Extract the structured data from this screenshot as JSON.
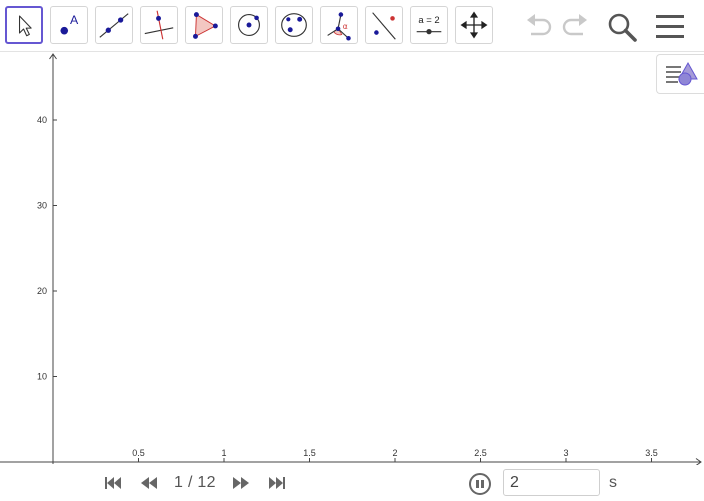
{
  "toolbar": {
    "tools": [
      {
        "name": "move-tool",
        "icon": "arrow-cursor-icon",
        "selected": true
      },
      {
        "name": "point-tool",
        "icon": "point-icon",
        "label": "A"
      },
      {
        "name": "line-tool",
        "icon": "line-through-points-icon"
      },
      {
        "name": "perpendicular-line-tool",
        "icon": "perpendicular-line-icon"
      },
      {
        "name": "polygon-tool",
        "icon": "polygon-icon"
      },
      {
        "name": "circle-tool",
        "icon": "circle-center-point-icon"
      },
      {
        "name": "conic-tool",
        "icon": "ellipse-icon"
      },
      {
        "name": "angle-tool",
        "icon": "angle-icon",
        "label": "α"
      },
      {
        "name": "reflect-tool",
        "icon": "reflect-about-line-icon"
      },
      {
        "name": "slider-tool",
        "icon": "slider-icon",
        "label": "a = 2"
      },
      {
        "name": "move-graphics-view-tool",
        "icon": "move-view-icon"
      }
    ],
    "undo_icon": "undo-icon",
    "redo_icon": "redo-icon",
    "search_icon": "search-icon",
    "menu_icon": "hamburger-menu-icon"
  },
  "style_bar_toggle_icon": "style-bar-icon",
  "graphics": {
    "x_ticks": [
      "0.5",
      "1",
      "1.5",
      "2",
      "2.5",
      "3",
      "3.5"
    ],
    "y_ticks": [
      "10",
      "20",
      "30",
      "40"
    ]
  },
  "player": {
    "slide_counter": "1 / 12",
    "speed_value": "2",
    "speed_unit": "s",
    "first_icon": "skip-to-start-icon",
    "prev_icon": "rewind-icon",
    "next_icon": "fast-forward-icon",
    "last_icon": "skip-to-end-icon",
    "pause_icon": "pause-icon"
  },
  "colors": {
    "accent": "#6557d2",
    "point": "#1a1a99",
    "shape_fill": "#f3c7c2",
    "shape_stroke": "#cc3333"
  }
}
